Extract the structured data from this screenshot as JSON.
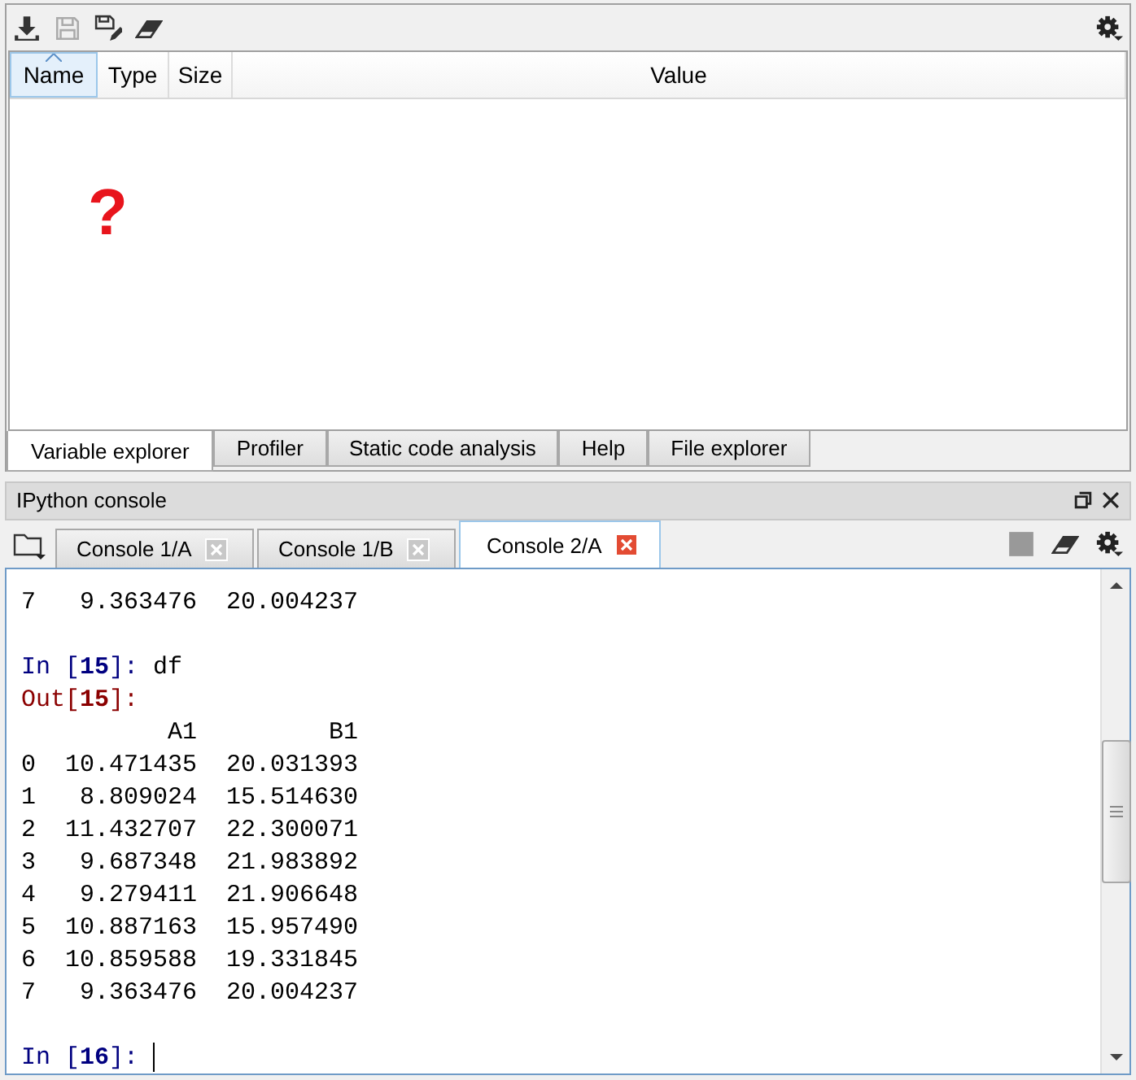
{
  "variable_explorer": {
    "columns": [
      {
        "label": "Name",
        "sorted": true
      },
      {
        "label": "Type",
        "sorted": false
      },
      {
        "label": "Size",
        "sorted": false
      },
      {
        "label": "Value",
        "sorted": false
      }
    ],
    "empty_mark": "?"
  },
  "pane_tabs": [
    {
      "label": "Variable explorer",
      "selected": true
    },
    {
      "label": "Profiler",
      "selected": false
    },
    {
      "label": "Static code analysis",
      "selected": false
    },
    {
      "label": "Help",
      "selected": false
    },
    {
      "label": "File explorer",
      "selected": false
    }
  ],
  "console": {
    "title": "IPython console",
    "tabs": [
      {
        "label": "Console 1/A",
        "selected": false
      },
      {
        "label": "Console 1/B",
        "selected": false
      },
      {
        "label": "Console 2/A",
        "selected": true
      }
    ],
    "lines": [
      {
        "kind": "output",
        "text": "7   9.363476  20.004237"
      },
      {
        "kind": "blank"
      },
      {
        "kind": "in",
        "prompt": "In [**15**]:",
        "code": "df"
      },
      {
        "kind": "out",
        "prompt": "Out[**15**]:"
      },
      {
        "kind": "output",
        "text": "          A1         B1"
      },
      {
        "kind": "output",
        "text": "0  10.471435  20.031393"
      },
      {
        "kind": "output",
        "text": "1   8.809024  15.514630"
      },
      {
        "kind": "output",
        "text": "2  11.432707  22.300071"
      },
      {
        "kind": "output",
        "text": "3   9.687348  21.983892"
      },
      {
        "kind": "output",
        "text": "4   9.279411  21.906648"
      },
      {
        "kind": "output",
        "text": "5  10.887163  15.957490"
      },
      {
        "kind": "output",
        "text": "6  10.859588  19.331845"
      },
      {
        "kind": "output",
        "text": "7   9.363476  20.004237"
      },
      {
        "kind": "blank"
      },
      {
        "kind": "in",
        "prompt": "In [**16**]:",
        "cursor": true
      }
    ]
  }
}
